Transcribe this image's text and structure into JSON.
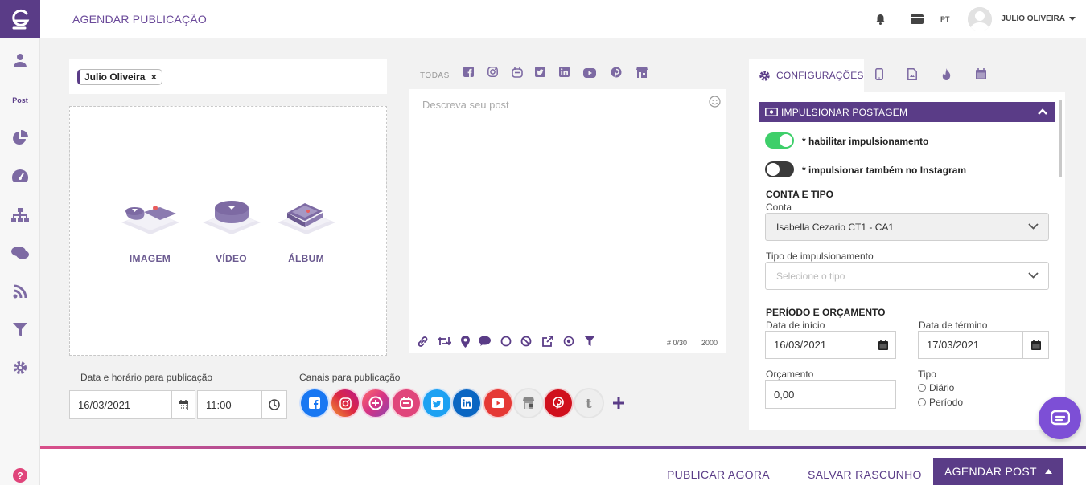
{
  "header": {
    "title": "AGENDAR PUBLICAÇÃO",
    "lang": "PT",
    "user_name": "JULIO OLIVEIRA"
  },
  "sidebar": {
    "post_label": "Post",
    "icons": [
      "user-icon",
      "pie-chart-icon",
      "dashboard-icon",
      "sitemap-icon",
      "comments-icon",
      "rss-icon",
      "filter-icon",
      "gear-icon",
      "help-icon"
    ]
  },
  "profiles": {
    "selected": "Julio Oliveira",
    "remove_symbol": "×"
  },
  "media": {
    "image": "IMAGEM",
    "video": "VÍDEO",
    "album": "ÁLBUM"
  },
  "schedule": {
    "label": "Data e horário para publicação",
    "date": "16/03/2021",
    "time": "11:00",
    "channels_label": "Canais para publicação"
  },
  "channels": [
    "facebook",
    "instagram",
    "google-my-business",
    "linkedin-page",
    "twitter",
    "linkedin",
    "youtube",
    "google-business",
    "pinterest",
    "tumblr"
  ],
  "editor": {
    "tab_all": "TODAS",
    "placeholder": "Descreva seu post",
    "hashtag_count": "# 0/30",
    "char_limit": "2000"
  },
  "config": {
    "tab_label": "CONFIGURAÇÕES",
    "boost_header": "IMPULSIONAR POSTAGEM",
    "enable_boost": "* habilitar impulsionamento",
    "boost_instagram": "* impulsionar também no Instagram",
    "enable_boost_on": true,
    "boost_instagram_on": false,
    "account_section": "CONTA E TIPO",
    "account_label": "Conta",
    "account_value": "Isabella Cezario CT1 - CA1",
    "boost_type_label": "Tipo de impulsionamento",
    "boost_type_placeholder": "Selecione o tipo",
    "period_section": "PERÍODO E ORÇAMENTO",
    "start_label": "Data de início",
    "start_value": "16/03/2021",
    "end_label": "Data de término",
    "end_value": "17/03/2021",
    "budget_label": "Orçamento",
    "budget_value": "0,00",
    "type_label": "Tipo",
    "type_daily": "Diário",
    "type_period": "Período"
  },
  "footer": {
    "publish_now": "PUBLICAR AGORA",
    "save_draft": "SALVAR RASCUNHO",
    "schedule_post": "AGENDAR POST"
  },
  "colors": {
    "brand": "#5a3c87",
    "toggle_on": "#3ecf6a"
  }
}
